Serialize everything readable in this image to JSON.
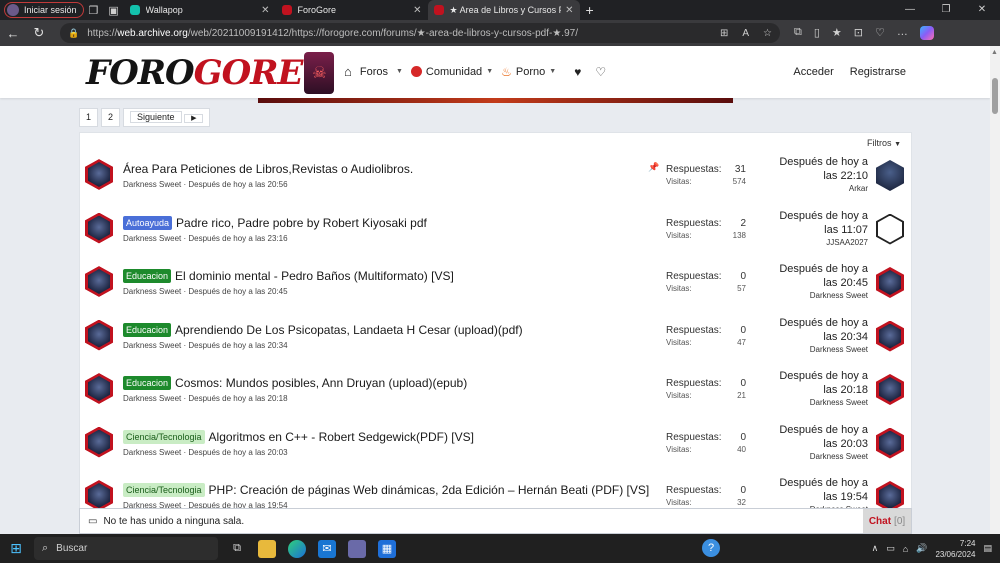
{
  "browser": {
    "profile_label": "Iniciar sesión",
    "tabs": [
      {
        "title": "Wallapop",
        "favicon_color": "#13c1ac",
        "active": false
      },
      {
        "title": "ForoGore",
        "favicon_color": "#c1121f",
        "active": false
      },
      {
        "title": "★ Area de Libros y Cursos PDF ★",
        "favicon_color": "#c1121f",
        "active": true
      }
    ],
    "url_prefix": "https://",
    "url_domain": "web.archive.org",
    "url_rest": "/web/20211009191412/https://forogore.com/forums/★-area-de-libros-y-cursos-pdf-★.97/"
  },
  "site": {
    "logo_black": "FORO",
    "logo_red": "GORE",
    "nav": {
      "foros": "Foros",
      "comunidad": "Comunidad",
      "porno": "Porno"
    },
    "account": {
      "login": "Acceder",
      "register": "Registrarse"
    }
  },
  "pager": {
    "pages": [
      "1",
      "2"
    ],
    "next": "Siguiente"
  },
  "filters_label": "Filtros",
  "labels": {
    "replies": "Respuestas:",
    "views": "Visitas:"
  },
  "threads": [
    {
      "prefix": "",
      "prefix_style": "",
      "title": "Área Para Peticiones de Libros,Revistas o Audiolibros.",
      "author": "Darkness Sweet",
      "date": "Después de hoy a las 20:56",
      "pinned": true,
      "replies": "31",
      "views": "574",
      "last_date": "Después de hoy a las 22:10",
      "last_user": "Arkar",
      "last_avatar": "dark"
    },
    {
      "prefix": "Autoayuda",
      "prefix_style": "auto",
      "title": "Padre rico, Padre pobre by Robert Kiyosaki pdf",
      "author": "Darkness Sweet",
      "date": "Después de hoy a las 23:16",
      "pinned": false,
      "replies": "2",
      "views": "138",
      "last_date": "Después de hoy a las 11:07",
      "last_user": "JJSAA2027",
      "last_avatar": "white"
    },
    {
      "prefix": "Educacion",
      "prefix_style": "edu",
      "title": "El dominio mental - Pedro Baños (Multiformato) [VS]",
      "author": "Darkness Sweet",
      "date": "Después de hoy a las 20:45",
      "pinned": false,
      "replies": "0",
      "views": "57",
      "last_date": "Después de hoy a las 20:45",
      "last_user": "Darkness Sweet",
      "last_avatar": "red"
    },
    {
      "prefix": "Educacion",
      "prefix_style": "edu",
      "title": "Aprendiendo De Los Psicopatas, Landaeta H Cesar (upload)(pdf)",
      "author": "Darkness Sweet",
      "date": "Después de hoy a las 20:34",
      "pinned": false,
      "replies": "0",
      "views": "47",
      "last_date": "Después de hoy a las 20:34",
      "last_user": "Darkness Sweet",
      "last_avatar": "red"
    },
    {
      "prefix": "Educacion",
      "prefix_style": "edu",
      "title": "Cosmos: Mundos posibles, Ann Druyan (upload)(epub)",
      "author": "Darkness Sweet",
      "date": "Después de hoy a las 20:18",
      "pinned": false,
      "replies": "0",
      "views": "21",
      "last_date": "Después de hoy a las 20:18",
      "last_user": "Darkness Sweet",
      "last_avatar": "red"
    },
    {
      "prefix": "Ciencia/Tecnologia",
      "prefix_style": "cien",
      "title": "Algoritmos en C++ - Robert Sedgewick(PDF) [VS]",
      "author": "Darkness Sweet",
      "date": "Después de hoy a las 20:03",
      "pinned": false,
      "replies": "0",
      "views": "40",
      "last_date": "Después de hoy a las 20:03",
      "last_user": "Darkness Sweet",
      "last_avatar": "red"
    },
    {
      "prefix": "Ciencia/Tecnologia",
      "prefix_style": "cien",
      "title": "PHP: Creación de páginas Web dinámicas, 2da Edición – Hernán Beati (PDF) [VS]",
      "author": "Darkness Sweet",
      "date": "Después de hoy a las 19:54",
      "pinned": false,
      "replies": "0",
      "views": "32",
      "last_date": "Después de hoy a las 19:54",
      "last_user": "Darkness Sweet",
      "last_avatar": "red"
    }
  ],
  "chat": {
    "message": "No te has unido a ninguna sala.",
    "label": "Chat",
    "count": "[0]"
  },
  "taskbar": {
    "search_placeholder": "Buscar",
    "time": "7:24",
    "date": "23/06/2024"
  }
}
